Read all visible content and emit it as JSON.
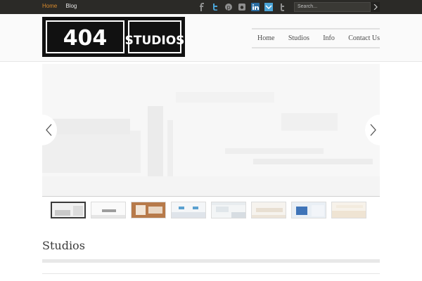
{
  "topbar": {
    "nav": [
      {
        "label": "Home",
        "active": true
      },
      {
        "label": "Blog",
        "active": false
      }
    ],
    "social": [
      "facebook-icon",
      "twitter-icon",
      "pinterest-icon",
      "instagram-icon",
      "linkedin-icon",
      "delicious-icon",
      "tumblr-icon"
    ],
    "search": {
      "placeholder": "Search..."
    },
    "colors": {
      "bar": "#2b2a27",
      "active_link": "#d98a2b"
    }
  },
  "header": {
    "logo": {
      "left_text": "404",
      "right_text": "STUDIOS"
    },
    "nav": [
      "Home",
      "Studios",
      "Info",
      "Contact Us"
    ]
  },
  "slider": {
    "thumbnails": 8,
    "active_thumbnail": 1
  },
  "section": {
    "title": "Studios"
  }
}
